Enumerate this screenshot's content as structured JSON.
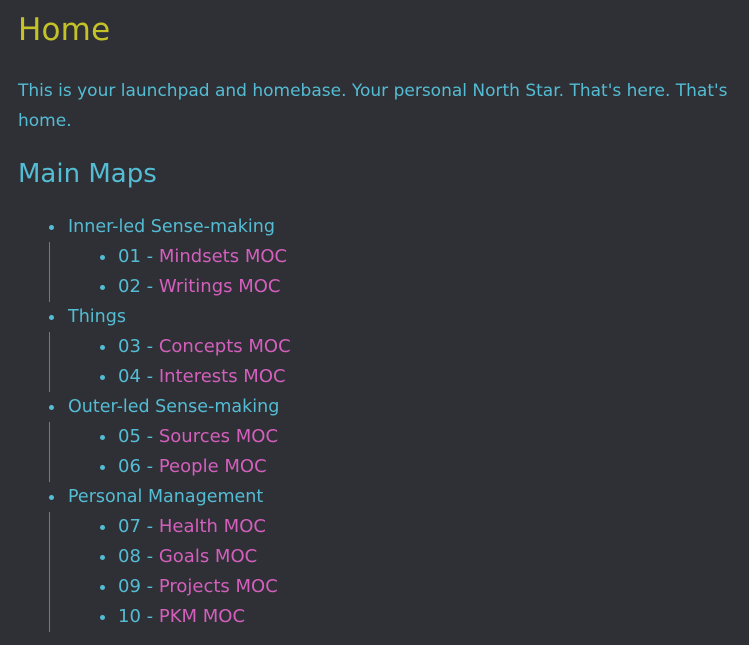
{
  "page": {
    "title": "Home",
    "intro": "This is your launchpad and homebase. Your personal North Star. That's here. That's home.",
    "section_heading": "Main Maps"
  },
  "colors": {
    "background": "#2e3036",
    "title": "#c5c228",
    "text": "#54bcd3",
    "link": "#d45fbc"
  },
  "groups": [
    {
      "label": "Inner-led Sense-making",
      "items": [
        {
          "prefix": "01 - ",
          "link": "Mindsets MOC"
        },
        {
          "prefix": "02 - ",
          "link": "Writings MOC"
        }
      ]
    },
    {
      "label": "Things",
      "items": [
        {
          "prefix": "03 - ",
          "link": "Concepts MOC"
        },
        {
          "prefix": "04 - ",
          "link": "Interests MOC"
        }
      ]
    },
    {
      "label": "Outer-led Sense-making",
      "items": [
        {
          "prefix": "05 - ",
          "link": "Sources MOC"
        },
        {
          "prefix": "06 - ",
          "link": "People MOC"
        }
      ]
    },
    {
      "label": "Personal Management",
      "items": [
        {
          "prefix": "07 - ",
          "link": "Health MOC"
        },
        {
          "prefix": "08 - ",
          "link": "Goals MOC"
        },
        {
          "prefix": "09 - ",
          "link": "Projects MOC"
        },
        {
          "prefix": "10 - ",
          "link": "PKM MOC"
        }
      ]
    }
  ]
}
